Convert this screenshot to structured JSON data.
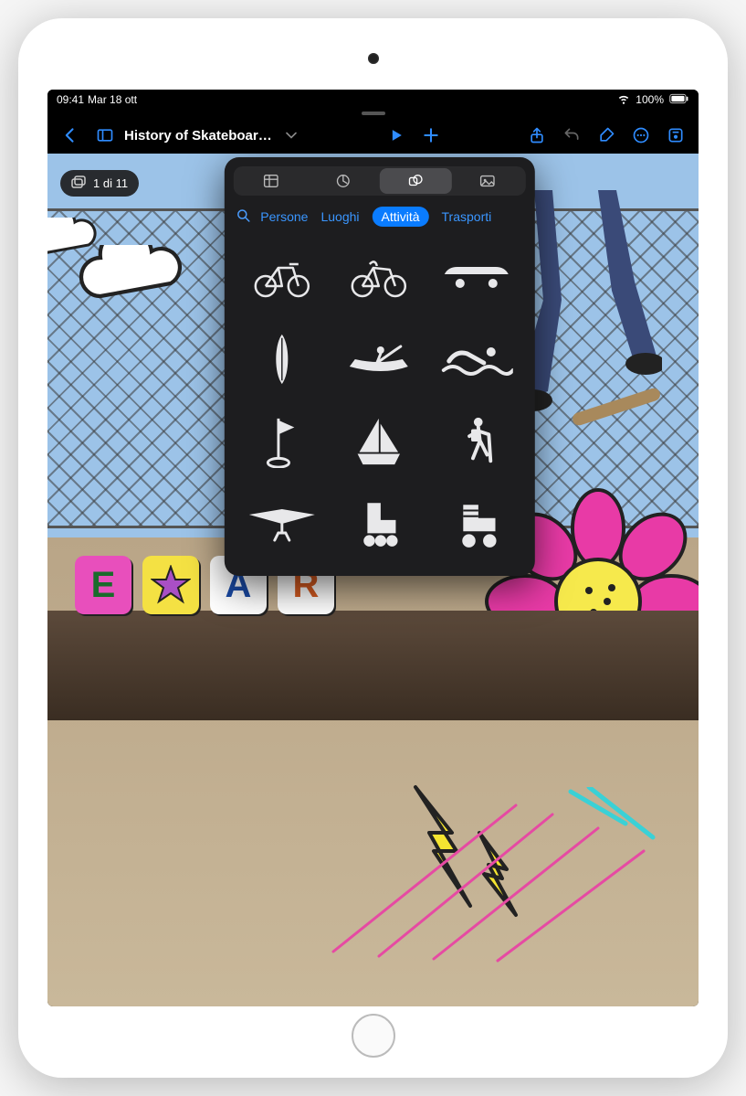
{
  "status": {
    "time": "09:41",
    "date": "Mar 18 ott",
    "battery": "100%"
  },
  "toolbar": {
    "doc_title": "History of Skateboar…"
  },
  "slide_counter": {
    "text": "1 di 11"
  },
  "popover": {
    "segments": [
      {
        "name": "tables-segment"
      },
      {
        "name": "charts-segment"
      },
      {
        "name": "shapes-segment",
        "active": true
      },
      {
        "name": "media-segment"
      }
    ],
    "categories": [
      {
        "label": "Persone",
        "active": false,
        "clipped": true
      },
      {
        "label": "Luoghi",
        "active": false
      },
      {
        "label": "Attività",
        "active": true
      },
      {
        "label": "Trasporti",
        "active": false
      }
    ],
    "shapes": [
      {
        "name": "bicycle-1-icon",
        "kind": "bicycle"
      },
      {
        "name": "bicycle-2-icon",
        "kind": "bicycle2"
      },
      {
        "name": "skateboard-icon",
        "kind": "skateboard"
      },
      {
        "name": "surfboard-icon",
        "kind": "surfboard"
      },
      {
        "name": "rowing-icon",
        "kind": "rowing"
      },
      {
        "name": "swimming-icon",
        "kind": "swimming"
      },
      {
        "name": "golf-flag-icon",
        "kind": "golf"
      },
      {
        "name": "sailboat-icon",
        "kind": "sailboat"
      },
      {
        "name": "hiker-icon",
        "kind": "hiker"
      },
      {
        "name": "hang-glider-icon",
        "kind": "glider"
      },
      {
        "name": "rollerblade-icon",
        "kind": "rollerblade"
      },
      {
        "name": "rollerskate-icon",
        "kind": "rollerskate"
      }
    ]
  },
  "colors": {
    "accent": "#0a7cff",
    "toolbar_icon": "#2f8cff"
  }
}
